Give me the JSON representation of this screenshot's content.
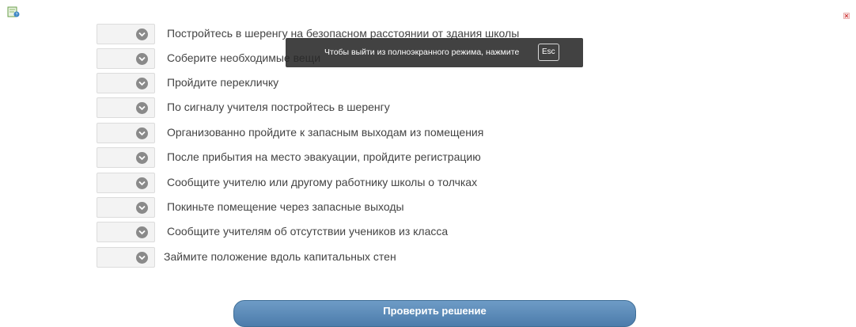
{
  "steps": [
    {
      "label": "Постройтесь в шеренгу на безопасном расстоянии от здания школы"
    },
    {
      "label": "Соберите необходимые вещи"
    },
    {
      "label": "Пройдите перекличку"
    },
    {
      "label": "По сигналу учителя постройтесь в шеренгу"
    },
    {
      "label": "Организованно пройдите к запасным выходам из помещения"
    },
    {
      "label": "После прибытия на место эвакуации, пройдите регистрацию"
    },
    {
      "label": "Сообщите учителю или другому работнику школы о толчках"
    },
    {
      "label": "Покиньте помещение через запасные выходы"
    },
    {
      "label": "Сообщите учителям об отсутствии учеников из класса"
    },
    {
      "label": "Займите положение вдоль капитальных стен"
    }
  ],
  "fullscreen_notice": {
    "text": "Чтобы выйти из полноэкранного режима, нажмите",
    "key": "Esc"
  },
  "check_button": {
    "label": "Проверить решение"
  },
  "colors": {
    "button": "#5b8bb8",
    "toast": "#2b2b2b",
    "chevron": "#8a8a8a"
  }
}
